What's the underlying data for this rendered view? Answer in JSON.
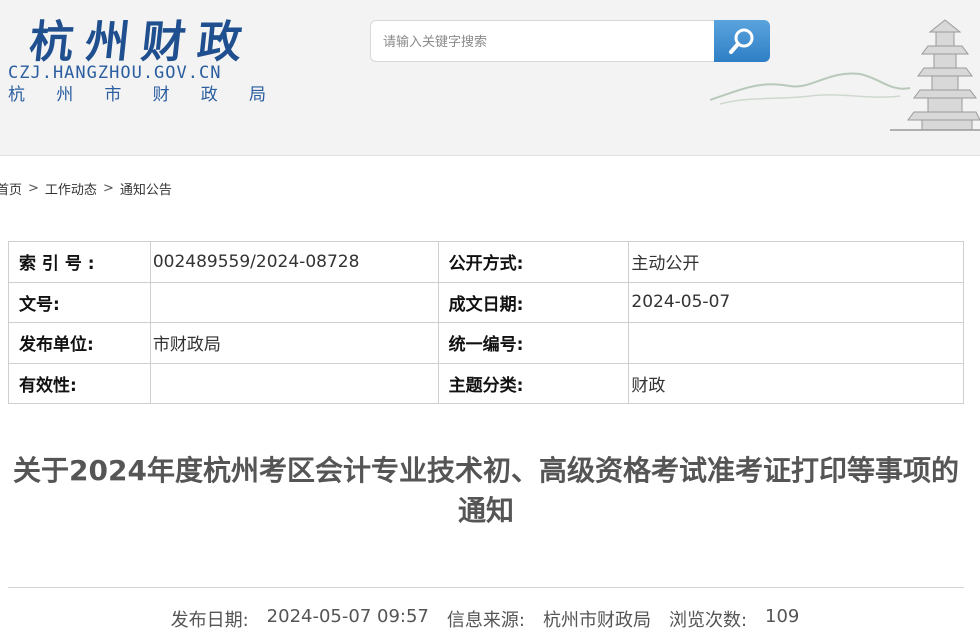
{
  "header": {
    "logo_cn": "杭州财政",
    "logo_en": "CZJ.HANGZHOU.GOV.CN",
    "logo_sub": [
      "杭",
      "州",
      "市",
      "财",
      "政",
      "局"
    ],
    "search_placeholder": "请输入关键字搜索",
    "search_icon": "magnifier-icon"
  },
  "breadcrumb": {
    "items": [
      "首页",
      "工作动态",
      "通知公告"
    ],
    "separator": ">"
  },
  "meta": {
    "rows": [
      {
        "l1": "索 引 号 :",
        "v1": "002489559/2024-08728",
        "l2": "公开方式:",
        "v2": "主动公开"
      },
      {
        "l1": "文号:",
        "v1": "",
        "l2": "成文日期:",
        "v2": "2024-05-07"
      },
      {
        "l1": "发布单位:",
        "v1": "市财政局",
        "l2": "统一编号:",
        "v2": ""
      },
      {
        "l1": "有效性:",
        "v1": "",
        "l2": "主题分类:",
        "v2": "财政"
      }
    ]
  },
  "article": {
    "title": "关于2024年度杭州考区会计专业技术初、高级资格考试准考证打印等事项的通知",
    "publish_label": "发布日期:",
    "publish_value": "2024-05-07 09:57",
    "source_label": "信息来源:",
    "source_value": "杭州市财政局",
    "views_label": "浏览次数:",
    "views_value": "109"
  },
  "colors": {
    "brand_blue": "#1f4f8f",
    "search_button": "#3b8bd0"
  }
}
